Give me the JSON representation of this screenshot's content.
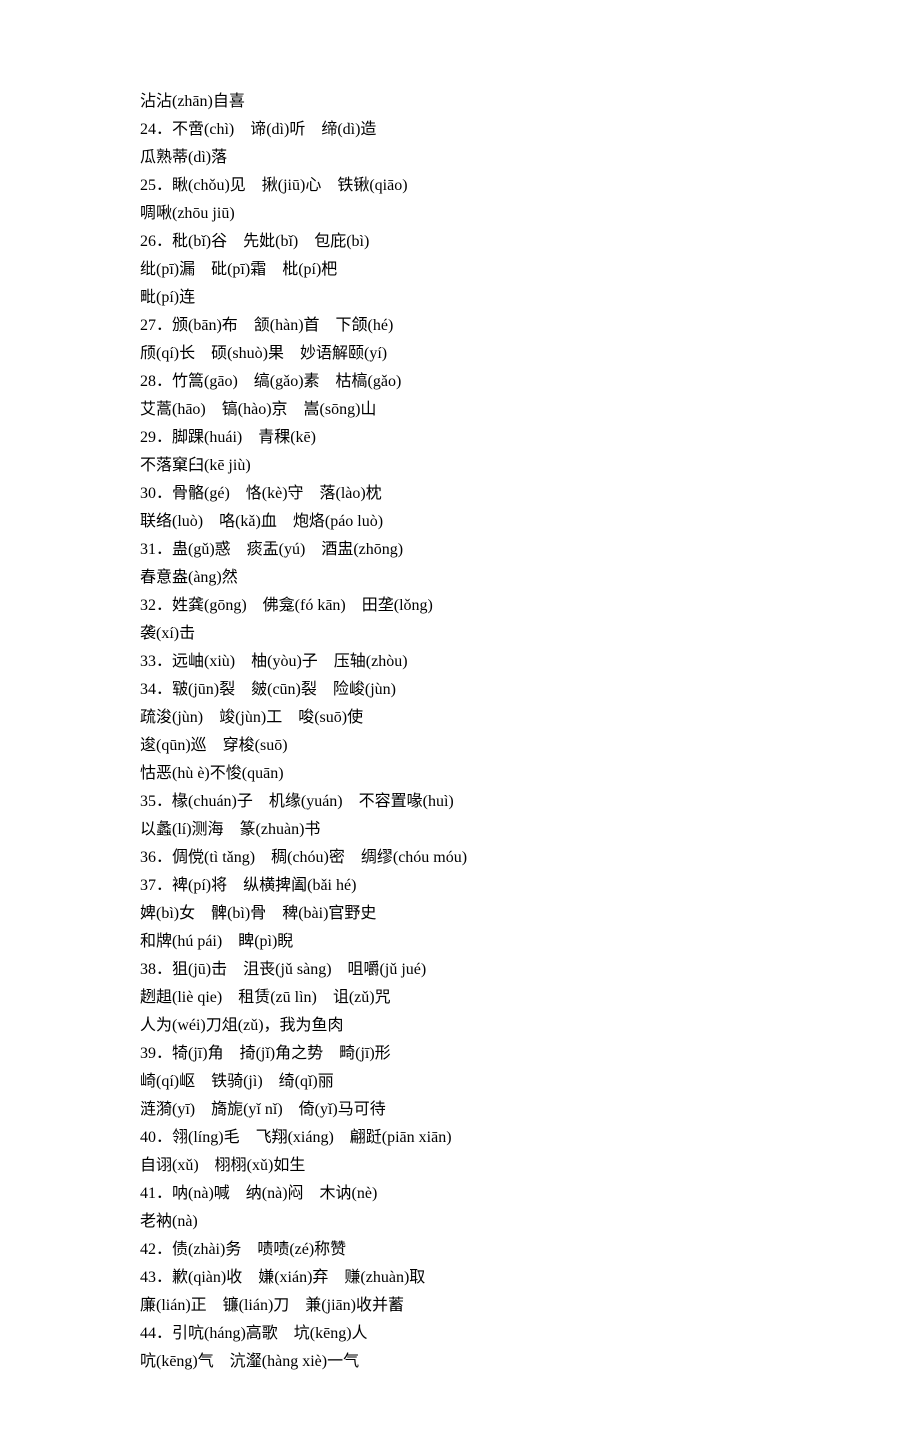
{
  "entries": [
    {
      "lines": [
        "沾沾(zhān)自喜"
      ]
    },
    {
      "num": "24",
      "lines": [
        "不啻(chì)　谛(dì)听　缔(dì)造",
        "瓜熟蒂(dì)落"
      ]
    },
    {
      "num": "25",
      "lines": [
        "瞅(chǒu)见　揪(jiū)心　铁锹(qiāo)",
        "啁啾(zhōu jiū)"
      ]
    },
    {
      "num": "26",
      "lines": [
        "秕(bǐ)谷　先妣(bǐ)　包庇(bì)",
        "纰(pī)漏　砒(pī)霜　枇(pí)杷",
        "毗(pí)连"
      ]
    },
    {
      "num": "27",
      "lines": [
        "颁(bān)布　颔(hàn)首　下颌(hé)",
        "颀(qí)长　硕(shuò)果　妙语解颐(yí)"
      ]
    },
    {
      "num": "28",
      "lines": [
        "竹篙(gāo)　缟(gǎo)素　枯槁(gǎo)",
        "艾蒿(hāo)　镐(hào)京　嵩(sōng)山"
      ]
    },
    {
      "num": "29",
      "lines": [
        "脚踝(huái)　青稞(kē)",
        "不落窠臼(kē jiù)"
      ]
    },
    {
      "num": "30",
      "lines": [
        "骨骼(gé)　恪(kè)守　落(lào)枕",
        "联络(luò)　咯(kǎ)血　炮烙(páo luò)"
      ]
    },
    {
      "num": "31",
      "lines": [
        "蛊(gǔ)惑　痰盂(yú)　酒盅(zhōng)",
        "春意盎(àng)然"
      ]
    },
    {
      "num": "32",
      "lines": [
        "姓龚(gōng)　佛龛(fó kān)　田垄(lǒng)",
        "袭(xí)击"
      ]
    },
    {
      "num": "33",
      "lines": [
        "远岫(xiù)　柚(yòu)子　压轴(zhòu)"
      ]
    },
    {
      "num": "34",
      "lines": [
        "皲(jūn)裂　皴(cūn)裂　险峻(jùn)",
        "疏浚(jùn)　竣(jùn)工　唆(suō)使",
        "逡(qūn)巡　穿梭(suō)",
        "怙恶(hù è)不悛(quān)"
      ]
    },
    {
      "num": "35",
      "lines": [
        "椽(chuán)子　机缘(yuán)　不容置喙(huì)",
        "以蠡(lí)测海　篆(zhuàn)书"
      ]
    },
    {
      "num": "36",
      "lines": [
        "倜傥(tì tǎng)　稠(chóu)密　绸缪(chóu móu)"
      ]
    },
    {
      "num": "37",
      "lines": [
        "裨(pí)将　纵横捭阖(bǎi hé)",
        "婢(bì)女　髀(bì)骨　稗(bài)官野史",
        "和牌(hú pái)　睥(pì)睨"
      ]
    },
    {
      "num": "38",
      "lines": [
        "狙(jū)击　沮丧(jǔ sàng)　咀嚼(jǔ jué)",
        "趔趄(liè qie)　租赁(zū lìn)　诅(zǔ)咒",
        "人为(wéi)刀俎(zǔ)，我为鱼肉"
      ]
    },
    {
      "num": "39",
      "lines": [
        "犄(jī)角　掎(jǐ)角之势　畸(jī)形",
        "崎(qí)岖　铁骑(jì)　绮(qǐ)丽",
        "涟漪(yī)　旖旎(yǐ nǐ)　倚(yǐ)马可待"
      ]
    },
    {
      "num": "40",
      "lines": [
        "翎(líng)毛　飞翔(xiáng)　翩跹(piān xiān)",
        "自诩(xǔ)　栩栩(xǔ)如生"
      ]
    },
    {
      "num": "41",
      "lines": [
        "呐(nà)喊　纳(nà)闷　木讷(nè)",
        "老衲(nà)"
      ]
    },
    {
      "num": "42",
      "lines": [
        "债(zhài)务　啧啧(zé)称赞"
      ]
    },
    {
      "num": "43",
      "lines": [
        "歉(qiàn)收　嫌(xián)弃　赚(zhuàn)取",
        "廉(lián)正　镰(lián)刀　兼(jiān)收并蓄"
      ]
    },
    {
      "num": "44",
      "lines": [
        "引吭(háng)高歌　坑(kēng)人",
        "吭(kēng)气　沆瀣(hàng xiè)一气"
      ]
    }
  ],
  "labels": {
    "dot": "．"
  }
}
